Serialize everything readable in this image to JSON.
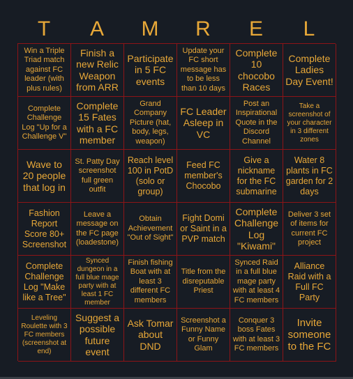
{
  "card": {
    "header_letters": [
      "T",
      "A",
      "M",
      "R",
      "E",
      "L"
    ],
    "colors": {
      "background": "#171c24",
      "text": "#e8a838",
      "grid_line": "#8e1417"
    },
    "cells": [
      [
        "Win a Triple Triad match against FC leader (with plus rules)",
        "Finish a new Relic Weapon from ARR",
        "Participate in 5 FC events",
        "Update your FC short message has to be less than 10 days",
        "Complete 10 chocobo Races",
        "Complete Ladies Day Event!"
      ],
      [
        "Complete Challenge Log \"Up for a Challenge V\"",
        "Complete 15 Fates with a FC member",
        "Grand Company Picture (hat, body, legs, weapon)",
        "FC Leader Asleep in VC",
        "Post an Inspirational Quote in the Discord Channel",
        "Take a screenshot of your character in 3 different zones"
      ],
      [
        "Wave to 20 people that log in",
        "St. Patty Day screenshot full green outfit",
        "Reach level 100 in PotD (solo or group)",
        "Feed FC member's Chocobo",
        "Give a nickname for the FC submarine",
        "Water 8 plants in FC garden for 2 days"
      ],
      [
        "Fashion Report Score 80+ Screenshot",
        "Leave a message on the FC page (loadestone)",
        "Obtain Achievement \"Out of Sight\"",
        "Fight Domi or Saint in a PVP match",
        "Complete Challenge Log \"Kiwami\"",
        "Deliver 3 set of items for current FC project"
      ],
      [
        "Complete Challenge Log \"Make like a Tree\"",
        "Synced dungeon in a full blue mage party with at least 1 FC member",
        "Finish fishing Boat with at least 3 different FC members",
        "Title from the disreputable Priest",
        "Synced Raid in a full blue mage party with at least 4 FC members",
        "Alliance Raid with a Full FC Party"
      ],
      [
        "Leveling Roulette with 3 FC members (screenshot at end)",
        "Suggest a possible future event",
        "Ask Tomar about DND",
        "Screenshot a Funny Name or Funny Glam",
        "Conquer 3 boss Fates with at least 3 FC members",
        "Invite someone to the FC"
      ]
    ]
  }
}
